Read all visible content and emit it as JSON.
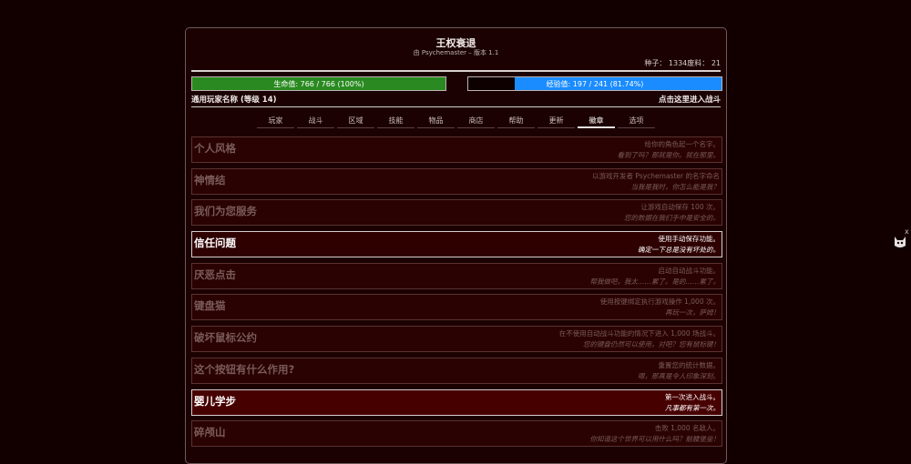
{
  "game": {
    "title": "王权衰退",
    "subtitle": "由 Psychemaster – 版本 1.1",
    "seed_line": "种子： 1334废料： 21"
  },
  "stats": {
    "hp_text": "生命值: 766 / 766 (100%)",
    "hp_fraction": 1.0,
    "xp_text": "经验值: 197 / 241 (81.74%)",
    "xp_fraction": 0.8174
  },
  "player": {
    "name_level": "通用玩家名称 (等级 14)",
    "battle_link": "点击这里进入战斗"
  },
  "tabs": [
    {
      "label": "玩家",
      "active": false
    },
    {
      "label": "战斗",
      "active": false
    },
    {
      "label": "区域",
      "active": false
    },
    {
      "label": "技能",
      "active": false
    },
    {
      "label": "物品",
      "active": false
    },
    {
      "label": "商店",
      "active": false
    },
    {
      "label": "帮助",
      "active": false
    },
    {
      "label": "更新",
      "active": false
    },
    {
      "label": "徽章",
      "active": true
    },
    {
      "label": "选项",
      "active": false
    }
  ],
  "badges": [
    {
      "name": "个人风格",
      "desc": "给你的角色起一个名字。",
      "flavor": "看到了吗？那就是你。就在那里。",
      "earned": false,
      "highlight": false
    },
    {
      "name": "神情结",
      "desc": "以游戏开发者 Psychemaster 的名字命名",
      "flavor": "当我是我时，你怎么能是我？",
      "earned": false,
      "highlight": false
    },
    {
      "name": "我们为您服务",
      "desc": "让游戏自动保存 100 次。",
      "flavor": "您的数据在我们手中是安全的。",
      "earned": false,
      "highlight": false
    },
    {
      "name": "信任问题",
      "desc": "使用手动保存功能。",
      "flavor": "确定一下总是没有坏处的。",
      "earned": true,
      "highlight": false
    },
    {
      "name": "厌恶点击",
      "desc": "启动自动战斗功能。",
      "flavor": "帮我做吧，我太……累了。是的……累了。",
      "earned": false,
      "highlight": false
    },
    {
      "name": "键盘猫",
      "desc": "使用按键绑定执行游戏操作 1,000 次。",
      "flavor": "再玩一次，萨姆！",
      "earned": false,
      "highlight": false
    },
    {
      "name": "破坏鼠标公约",
      "desc": "在不使用自动战斗功能的情况下进入 1,000 场战斗。",
      "flavor": "您的键盘仍然可以使用，对吧？您有鼠标键！",
      "earned": false,
      "highlight": false
    },
    {
      "name": "这个按钮有什么作用?",
      "desc": "重置您的统计数据。",
      "flavor": "嗯，那真是令人印象深刻。",
      "earned": false,
      "highlight": false
    },
    {
      "name": "婴儿学步",
      "desc": "第一次进入战斗。",
      "flavor": "凡事都有第一次。",
      "earned": true,
      "highlight": true
    },
    {
      "name": "碎颅山",
      "desc": "击败 1,000 名敌人。",
      "flavor": "你知道这个世界可以用什么吗？骷髅堡垒！",
      "earned": false,
      "highlight": false
    }
  ],
  "side": {
    "close_glyph": "x",
    "icon": "cat-icon"
  },
  "colors": {
    "hp": "#2a8a21",
    "xp": "#1a8cff",
    "background": "#120000"
  }
}
